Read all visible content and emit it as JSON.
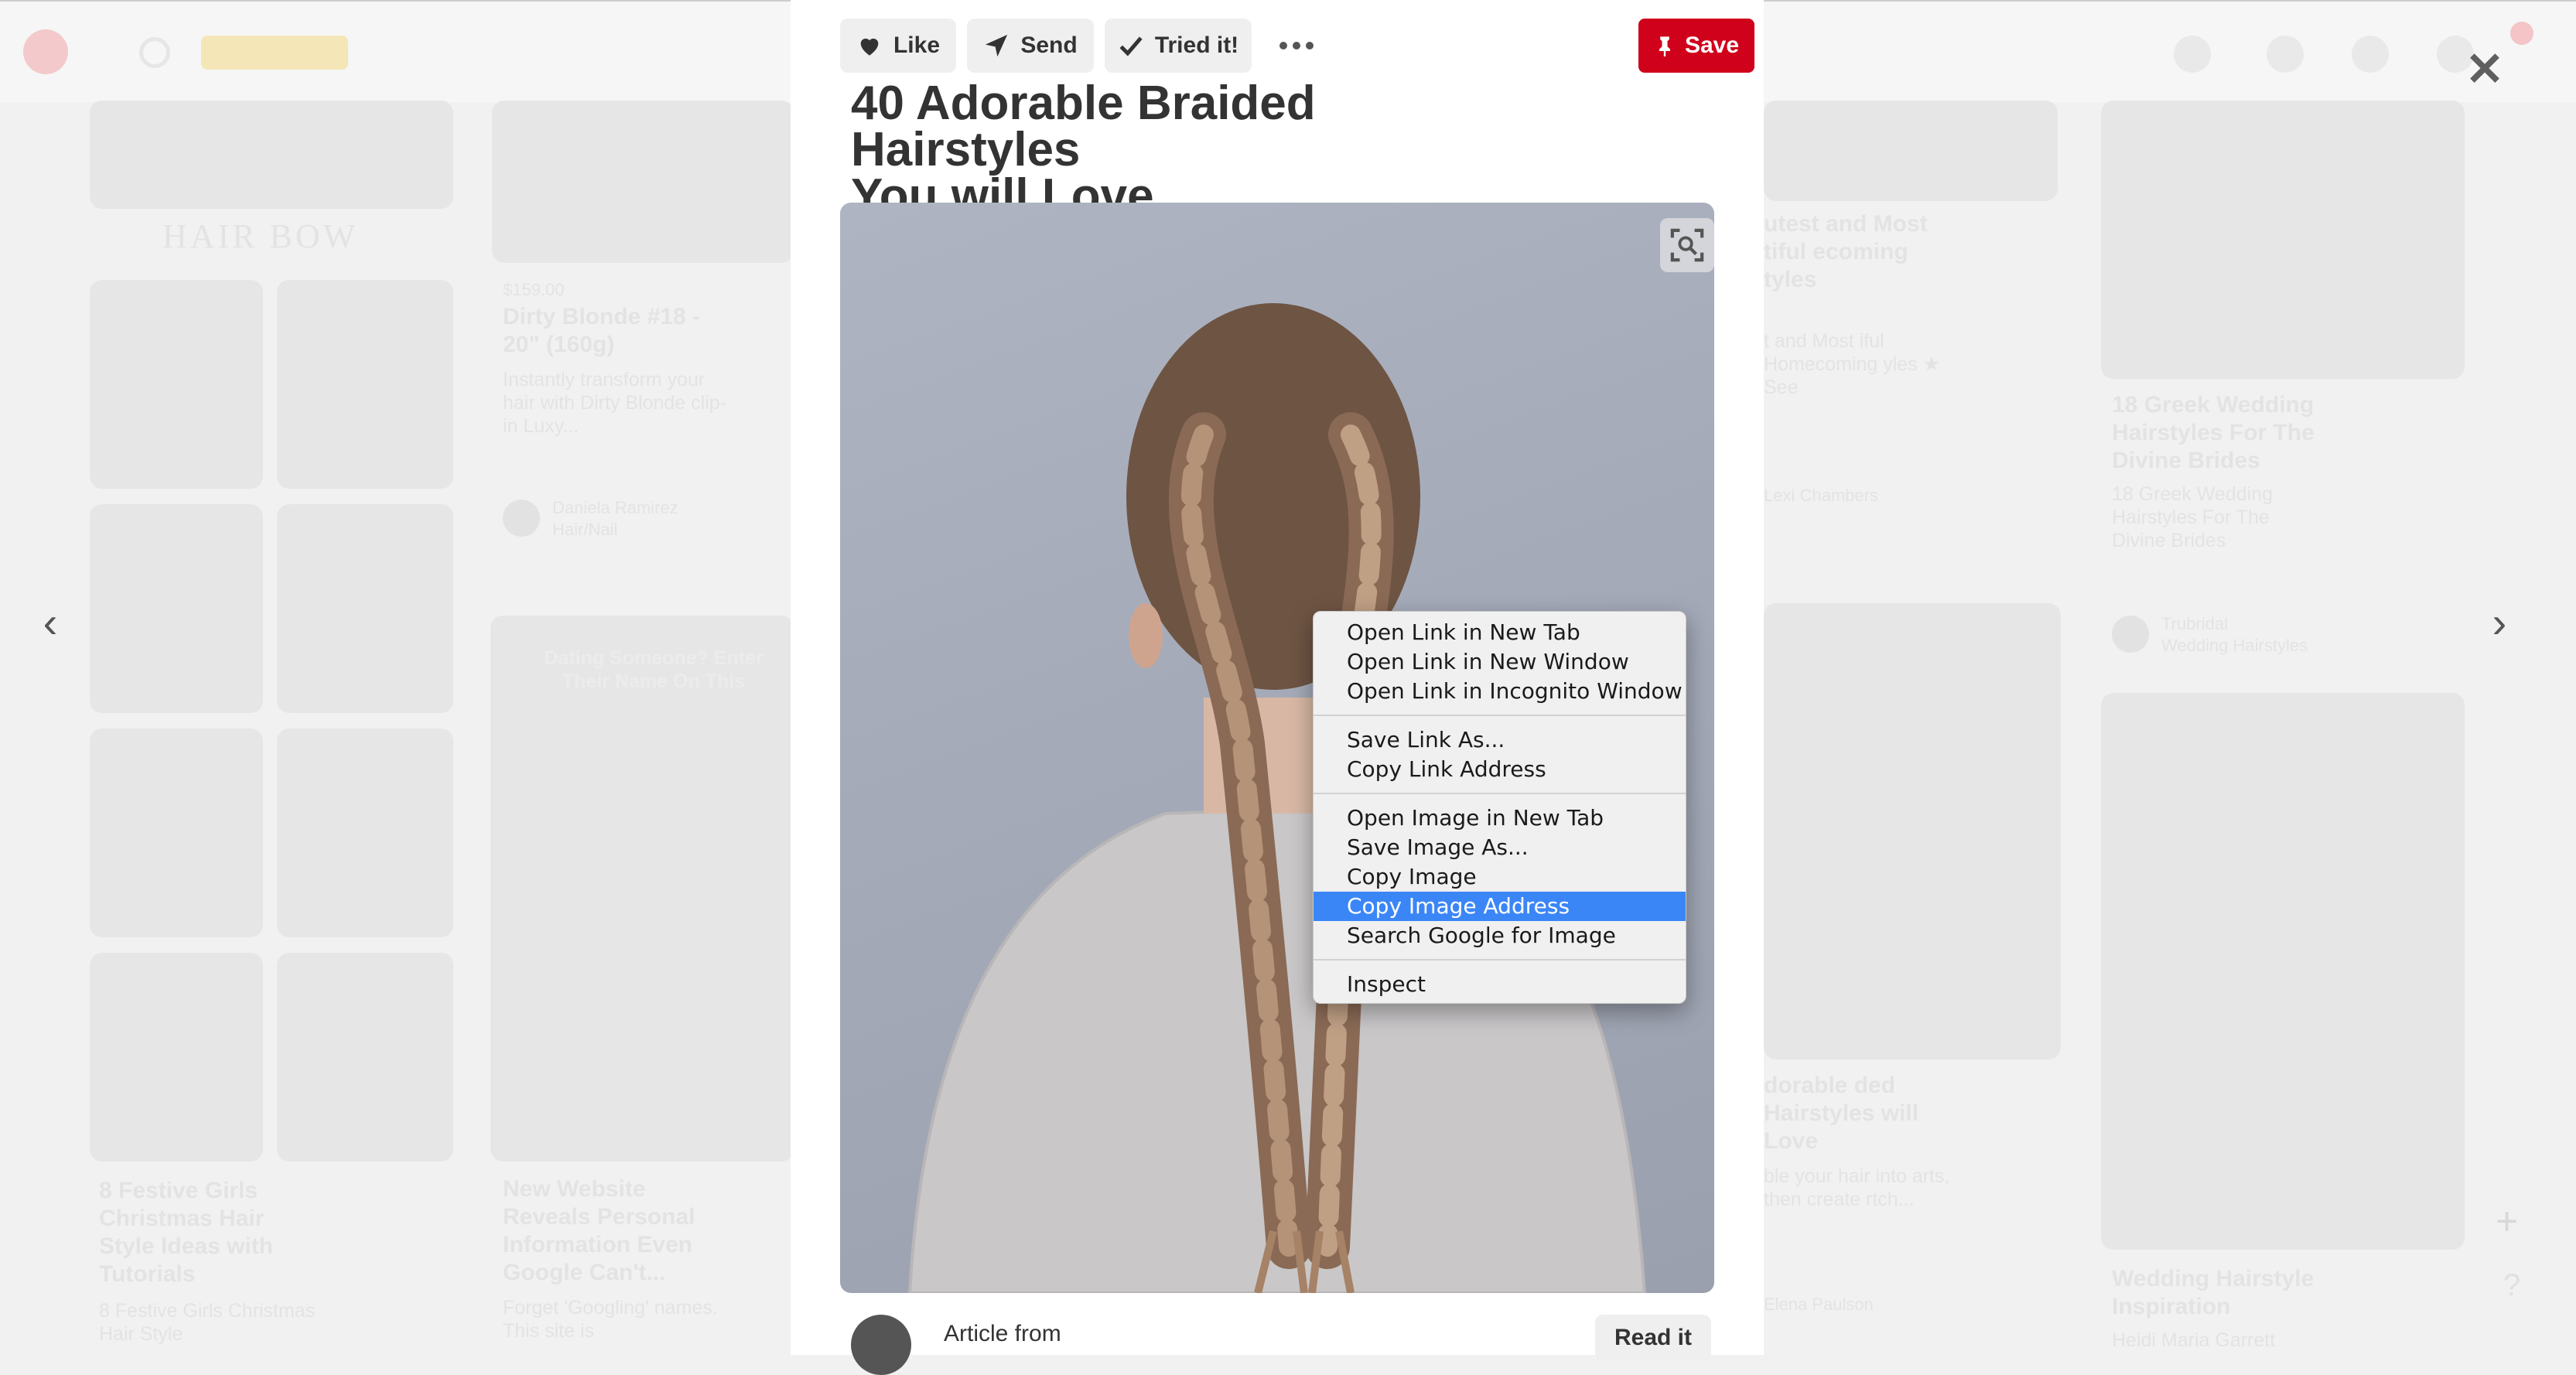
{
  "toolbar": {
    "like_label": "Like",
    "send_label": "Send",
    "tried_label": "Tried it!",
    "save_label": "Save"
  },
  "pin": {
    "title_line1": "40 Adorable Braided Hairstyles",
    "title_line2": "You will Love",
    "article_label": "Article from",
    "read_label": "Read it"
  },
  "context_menu": {
    "group1": [
      "Open Link in New Tab",
      "Open Link in New Window",
      "Open Link in Incognito Window"
    ],
    "group2": [
      "Save Link As...",
      "Copy Link Address"
    ],
    "group3": [
      "Open Image in New Tab",
      "Save Image As...",
      "Copy Image",
      "Copy Image Address",
      "Search Google for Image"
    ],
    "group4": [
      "Inspect"
    ],
    "highlighted": "Copy Image Address"
  },
  "background_feed": {
    "hair_bow_heading": "HAIR BOW",
    "card1_price": "$159.00",
    "card1_title": "Dirty Blonde #18 - 20\" (160g)",
    "card1_desc": "Instantly transform your hair with Dirty Blonde clip-in Luxy...",
    "card1_user": "Daniela Ramirez",
    "card1_board": "Hair/Nail",
    "ad_overlay": "Dating Someone? Enter Their Name On This",
    "card2_title": "New Website Reveals Personal Information Even Google Can't...",
    "card2_desc": "Forget 'Googling' names. This site is",
    "card3_title": "8 Festive Girls Christmas Hair Style Ideas with Tutorials",
    "card3_desc": "8 Festive Girls Christmas Hair Style",
    "card4_title": "utest and Most tiful ecoming tyles",
    "card4_desc": "t and Most iful Homecoming yles ★ See",
    "card4_user": "Lexi Chambers",
    "card5_title": "18 Greek Wedding Hairstyles For The Divine Brides",
    "card5_desc": "18 Greek Wedding Hairstyles For The Divine Brides",
    "card5_user": "Trubridal",
    "card5_board": "Wedding Hairstyles",
    "card6_title": "dorable ded Hairstyles will Love",
    "card6_desc": "ble your hair into arts, then create rtch...",
    "card6_user": "Elena Paulson",
    "card7_title": "Wedding Hairstyle Inspiration",
    "card7_desc": "Heidi Maria Garrett"
  },
  "colors": {
    "save_red": "#d0021b",
    "menu_highlight": "#3b86f7",
    "title_text": "#333333"
  }
}
